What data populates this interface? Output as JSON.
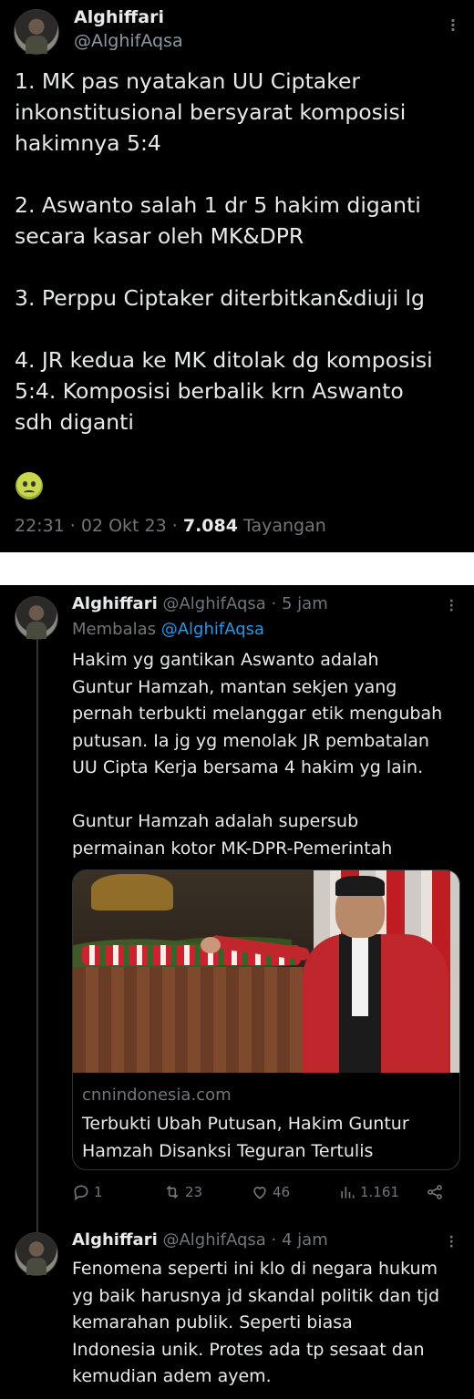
{
  "main_tweet": {
    "name": "Alghiffari",
    "handle": "@AlghifAqsa",
    "paragraphs": [
      "1. MK pas nyatakan UU Ciptaker\ninkonstitusional bersyarat komposisi\nhakimnya 5:4",
      "2. Aswanto salah 1 dr 5 hakim diganti\nsecara kasar oleh MK&DPR",
      "3. Perppu Ciptaker diterbitkan&diuji lg",
      "4. JR kedua ke MK ditolak dg komposisi\n5:4. Komposisi berbalik krn Aswanto\nsdh diganti"
    ],
    "emoji": "nauseated-face",
    "time": "22:31 · 02 Okt 23 · ",
    "views": "7.084",
    "views_label": " Tayangan",
    "more_icon": "more-vertical-icon"
  },
  "reply1": {
    "name": "Alghiffari",
    "handle": "@AlghifAqsa",
    "dot": " · ",
    "time": "5 jam",
    "replying_label": "Membalas ",
    "replying_to": "@AlghifAqsa",
    "paragraphs": [
      "Hakim yg gantikan Aswanto adalah\nGuntur Hamzah, mantan sekjen yang\npernah terbukti melanggar etik mengubah\nputusan. Ia jg yg menolak JR pembatalan\nUU Cipta Kerja bersama 4 hakim yg lain.",
      "Guntur Hamzah adalah supersub\npermainan kotor MK-DPR-Pemerintah"
    ],
    "card": {
      "domain": "cnnindonesia.com",
      "title": "Terbukti Ubah Putusan, Hakim Guntur\nHamzah Disanksi Teguran Tertulis"
    },
    "actions": {
      "reply_count": "1",
      "retweet_count": "23",
      "like_count": "46",
      "view_count": "1.161"
    }
  },
  "reply2": {
    "name": "Alghiffari",
    "handle": "@AlghifAqsa",
    "dot": " · ",
    "time": "4 jam",
    "text": "Fenomena seperti ini klo di negara hukum\nyg baik harusnya jd skandal politik dan tjd\nkemarahan publik. Seperti biasa\nIndonesia unik. Protes ada tp sesaat dan\nkemudian adem ayem."
  },
  "colors": {
    "background": "#000000",
    "text": "#e7e9ea",
    "secondary": "#71767b",
    "link": "#1d9bf0",
    "divider": "#ffffff"
  }
}
